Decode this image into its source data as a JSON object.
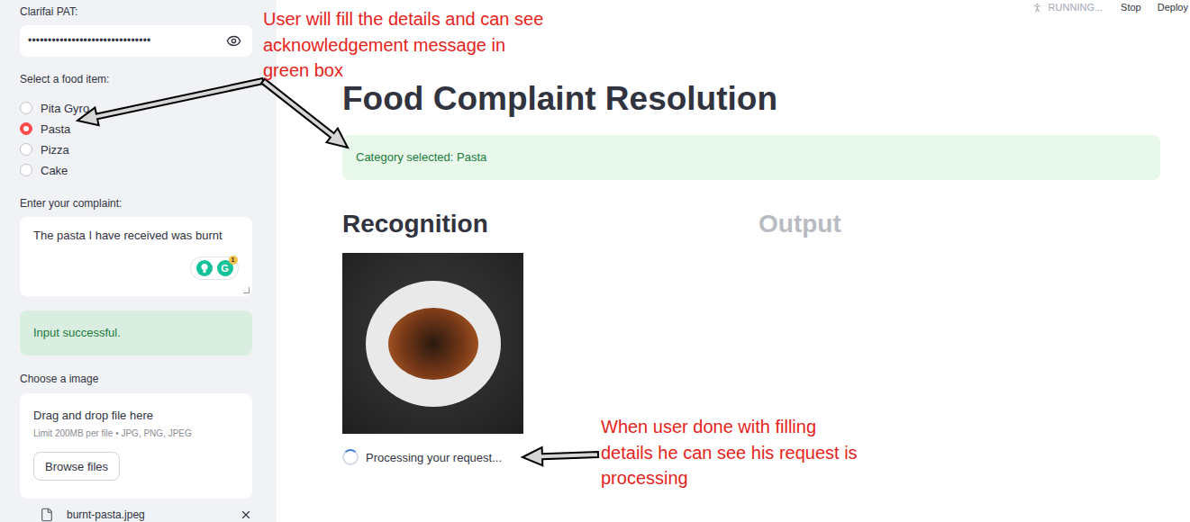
{
  "header": {
    "status": "RUNNING...",
    "buttons": [
      "Stop",
      "Deploy"
    ]
  },
  "sidebar": {
    "pat": {
      "label": "Clarifai PAT:",
      "value": "•••••••••••••••••••••••••••••••"
    },
    "food": {
      "label": "Select a food item:",
      "options": [
        {
          "label": "Pita Gyro",
          "selected": false
        },
        {
          "label": "Pasta",
          "selected": true
        },
        {
          "label": "Pizza",
          "selected": false
        },
        {
          "label": "Cake",
          "selected": false
        }
      ]
    },
    "complaint": {
      "label": "Enter your complaint:",
      "value": "The pasta I have received was burnt",
      "grammarly": {
        "logo": "G",
        "count": "1"
      }
    },
    "success": "Input successful.",
    "uploader": {
      "label": "Choose a image",
      "title": "Drag and drop file here",
      "limit": "Limit 200MB per file • JPG, PNG, JPEG",
      "button": "Browse files",
      "file": "burnt-pasta.jpeg"
    }
  },
  "main": {
    "title": "Food Complaint Resolution",
    "info": "Category selected: Pasta",
    "columns": [
      {
        "title": "Recognition",
        "faded": false
      },
      {
        "title": "Output",
        "faded": true
      }
    ],
    "spinner": "Processing your request..."
  },
  "annotations": [
    {
      "lines": [
        "User will fill the details and can see",
        "acknowledgement message in",
        "green box"
      ]
    },
    {
      "lines": [
        "When user done with filling",
        "details he can see his request is",
        "processing"
      ]
    }
  ]
}
